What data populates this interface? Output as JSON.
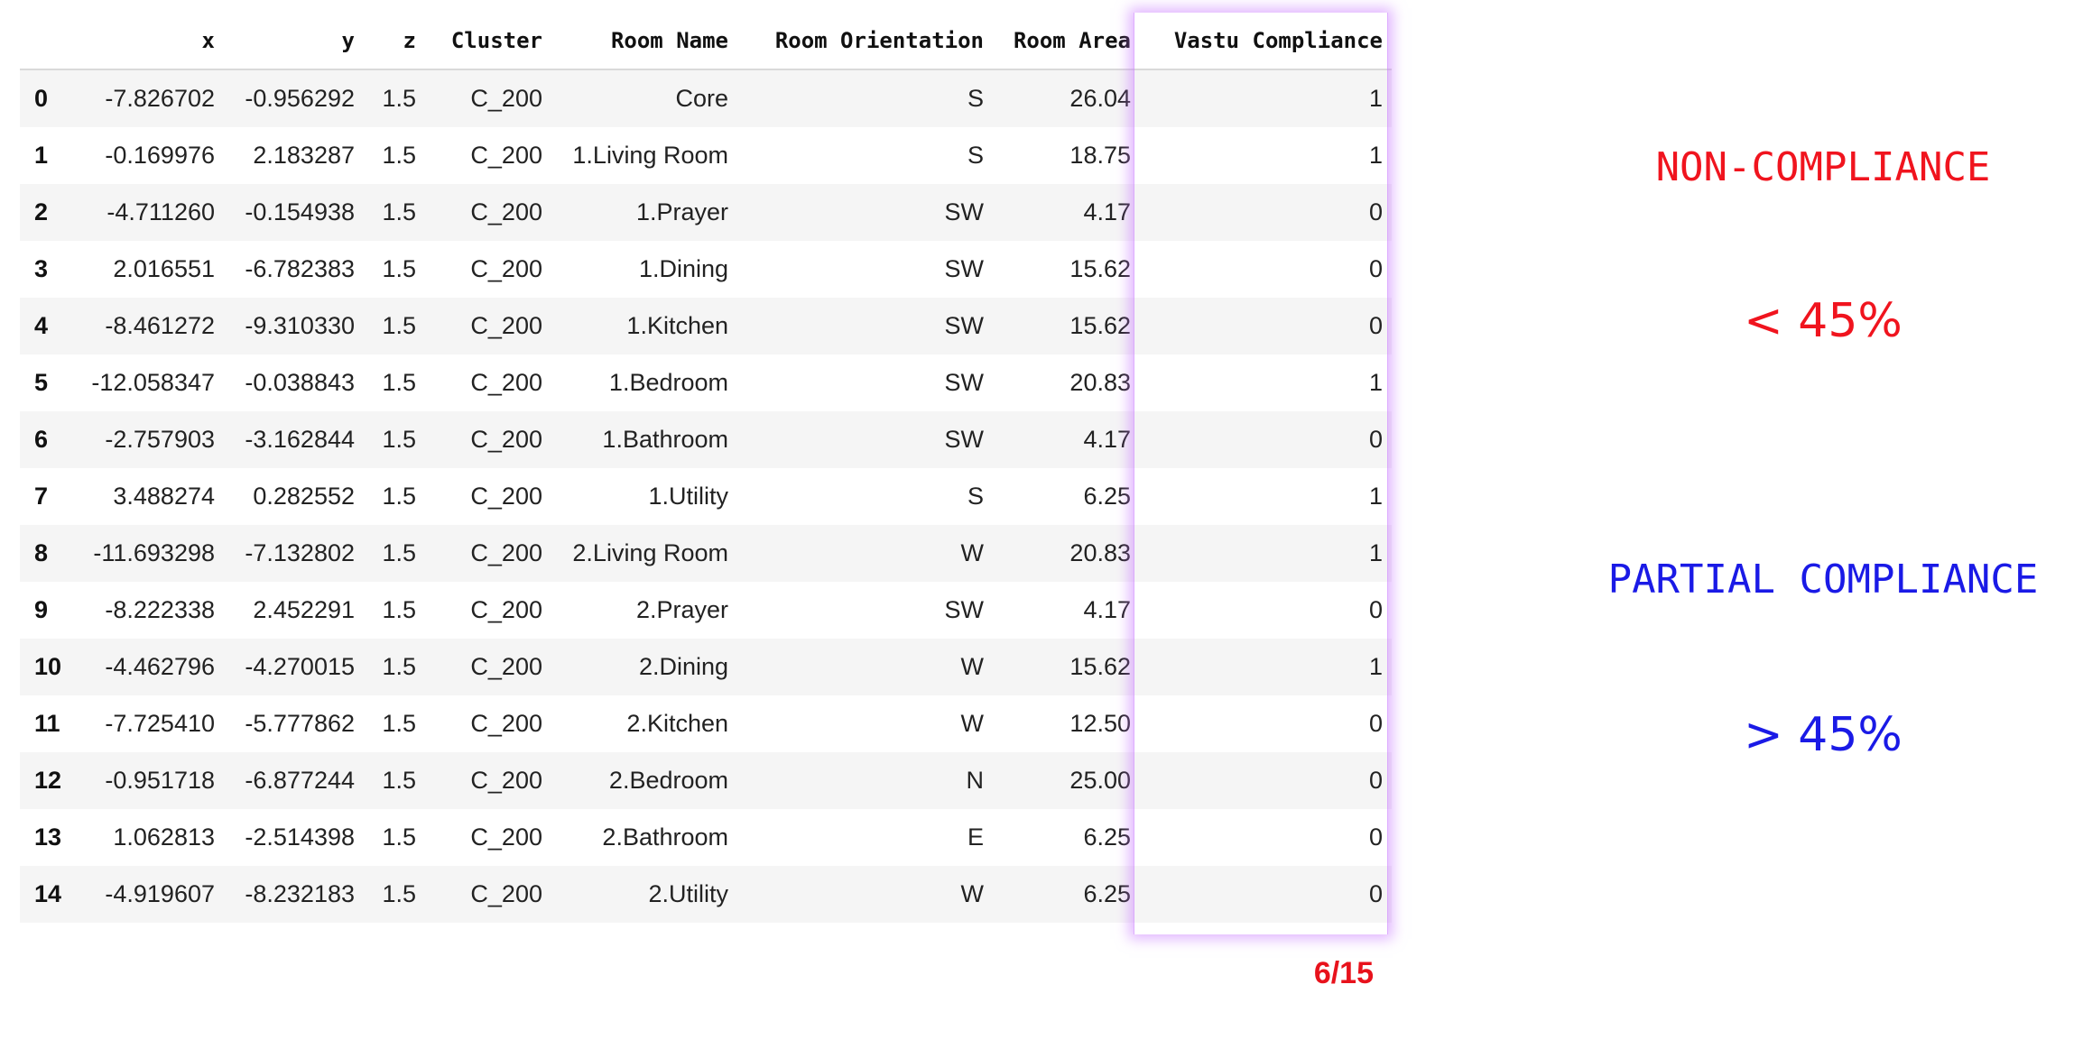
{
  "table": {
    "columns": [
      "",
      "x",
      "y",
      "z",
      "Cluster",
      "Room Name",
      "Room Orientation",
      "Room Area",
      "Vastu Compliance"
    ],
    "rows": [
      [
        "0",
        "-7.826702",
        "-0.956292",
        "1.5",
        "C_200",
        "Core",
        "S",
        "26.04",
        "1"
      ],
      [
        "1",
        "-0.169976",
        "2.183287",
        "1.5",
        "C_200",
        "1.Living Room",
        "S",
        "18.75",
        "1"
      ],
      [
        "2",
        "-4.711260",
        "-0.154938",
        "1.5",
        "C_200",
        "1.Prayer",
        "SW",
        "4.17",
        "0"
      ],
      [
        "3",
        "2.016551",
        "-6.782383",
        "1.5",
        "C_200",
        "1.Dining",
        "SW",
        "15.62",
        "0"
      ],
      [
        "4",
        "-8.461272",
        "-9.310330",
        "1.5",
        "C_200",
        "1.Kitchen",
        "SW",
        "15.62",
        "0"
      ],
      [
        "5",
        "-12.058347",
        "-0.038843",
        "1.5",
        "C_200",
        "1.Bedroom",
        "SW",
        "20.83",
        "1"
      ],
      [
        "6",
        "-2.757903",
        "-3.162844",
        "1.5",
        "C_200",
        "1.Bathroom",
        "SW",
        "4.17",
        "0"
      ],
      [
        "7",
        "3.488274",
        "0.282552",
        "1.5",
        "C_200",
        "1.Utility",
        "S",
        "6.25",
        "1"
      ],
      [
        "8",
        "-11.693298",
        "-7.132802",
        "1.5",
        "C_200",
        "2.Living Room",
        "W",
        "20.83",
        "1"
      ],
      [
        "9",
        "-8.222338",
        "2.452291",
        "1.5",
        "C_200",
        "2.Prayer",
        "SW",
        "4.17",
        "0"
      ],
      [
        "10",
        "-4.462796",
        "-4.270015",
        "1.5",
        "C_200",
        "2.Dining",
        "W",
        "15.62",
        "1"
      ],
      [
        "11",
        "-7.725410",
        "-5.777862",
        "1.5",
        "C_200",
        "2.Kitchen",
        "W",
        "12.50",
        "0"
      ],
      [
        "12",
        "-0.951718",
        "-6.877244",
        "1.5",
        "C_200",
        "2.Bedroom",
        "N",
        "25.00",
        "0"
      ],
      [
        "13",
        "1.062813",
        "-2.514398",
        "1.5",
        "C_200",
        "2.Bathroom",
        "E",
        "6.25",
        "0"
      ],
      [
        "14",
        "-4.919607",
        "-8.232183",
        "1.5",
        "C_200",
        "2.Utility",
        "W",
        "6.25",
        "0"
      ]
    ]
  },
  "score": "6/15",
  "legend": {
    "non_compliance": {
      "label": "NON-COMPLIANCE",
      "value": "< 45%",
      "color": "#f0141e"
    },
    "partial_compliance": {
      "label": "PARTIAL COMPLIANCE",
      "value": "> 45%",
      "color": "#1a1ae6"
    }
  },
  "colors": {
    "highlight": "#c878ff",
    "score": "#e8121c"
  }
}
